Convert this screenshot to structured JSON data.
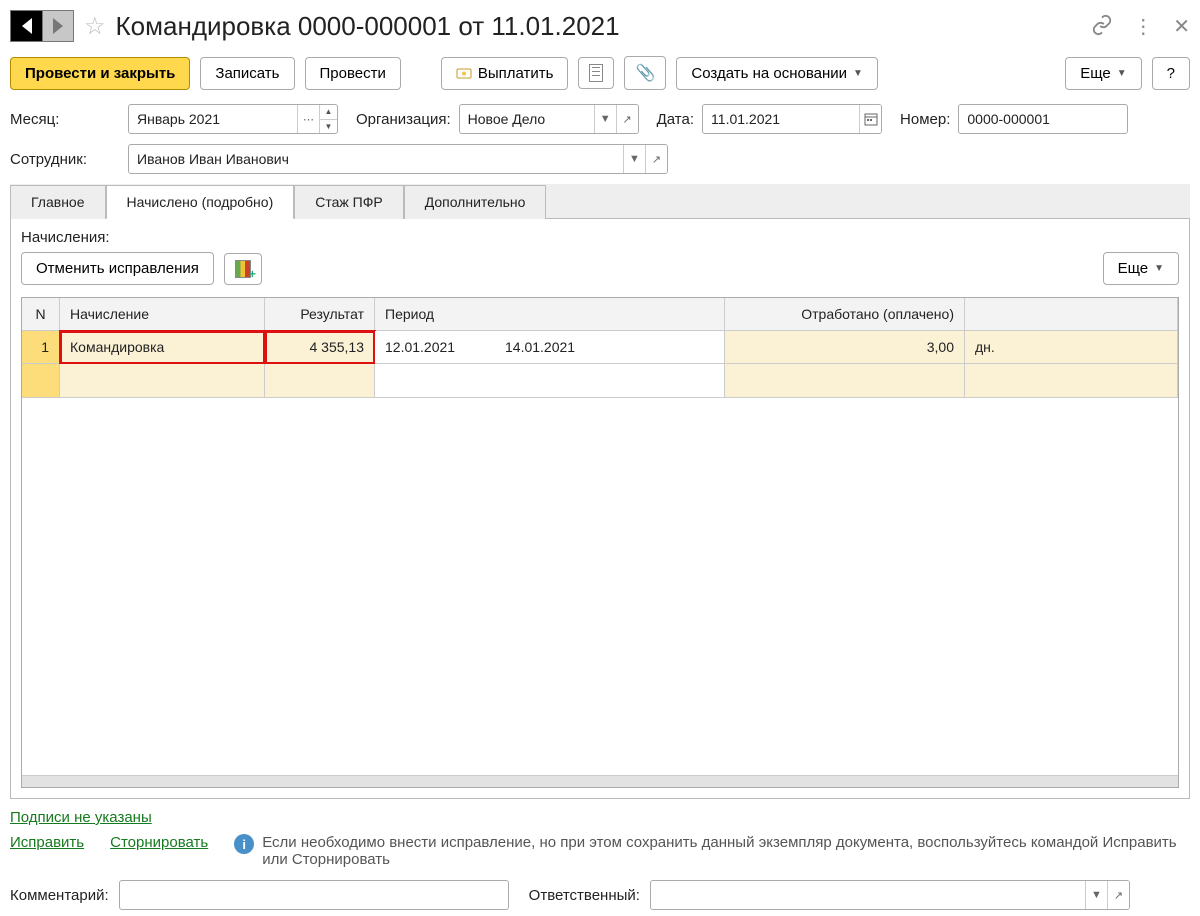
{
  "header": {
    "title": "Командировка 0000-000001 от 11.01.2021"
  },
  "toolbar": {
    "post_close": "Провести и закрыть",
    "save": "Записать",
    "post": "Провести",
    "pay": "Выплатить",
    "create_based": "Создать на основании",
    "more": "Еще",
    "help": "?"
  },
  "fields": {
    "month_label": "Месяц:",
    "month_value": "Январь 2021",
    "org_label": "Организация:",
    "org_value": "Новое Дело",
    "date_label": "Дата:",
    "date_value": "11.01.2021",
    "number_label": "Номер:",
    "number_value": "0000-000001",
    "employee_label": "Сотрудник:",
    "employee_value": "Иванов Иван Иванович"
  },
  "tabs": {
    "main": "Главное",
    "accrued": "Начислено (подробно)",
    "pfr": "Стаж ПФР",
    "extra": "Дополнительно"
  },
  "section": {
    "accruals_label": "Начисления:",
    "cancel_fix": "Отменить исправления",
    "more": "Еще"
  },
  "table": {
    "col_n": "N",
    "col_name": "Начисление",
    "col_res": "Результат",
    "col_period": "Период",
    "col_otr": "Отработано (оплачено)",
    "row1": {
      "n": "1",
      "name": "Командировка",
      "result": "4 355,13",
      "period_from": "12.01.2021",
      "period_to": "14.01.2021",
      "worked": "3,00",
      "unit": "дн."
    }
  },
  "footer": {
    "nosign": "Подписи не указаны",
    "fix": "Исправить",
    "storno": "Сторнировать",
    "info": "Если необходимо внести исправление, но при этом сохранить данный экземпляр документа, воспользуйтесь командой Исправить или Сторнировать",
    "comment_label": "Комментарий:",
    "responsible_label": "Ответственный:"
  }
}
